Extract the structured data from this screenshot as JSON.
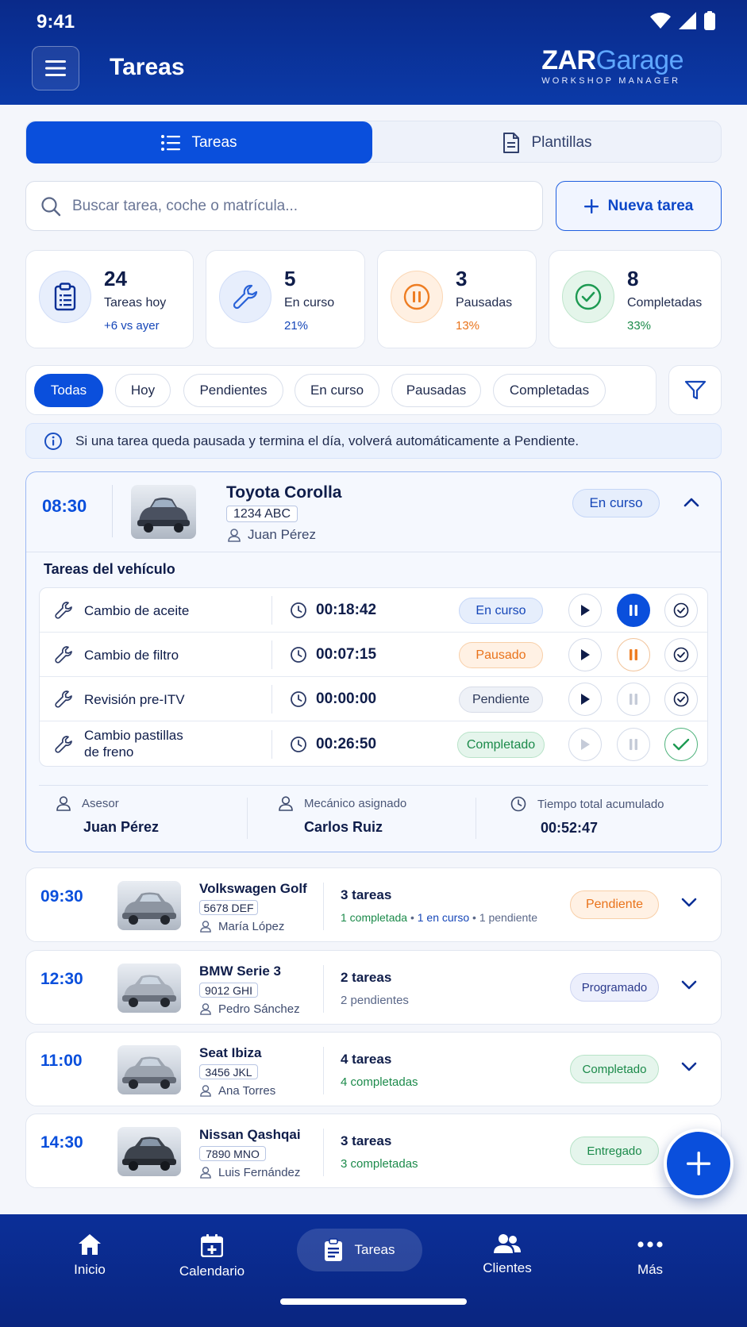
{
  "status_bar": {
    "time": "9:41"
  },
  "header": {
    "title": "Tareas",
    "logo_zar": "ZAR",
    "logo_garage": "Garage",
    "logo_sub": "WORKSHOP MANAGER"
  },
  "tabs": [
    {
      "label": "Tareas",
      "active": true
    },
    {
      "label": "Plantillas",
      "active": false
    }
  ],
  "search": {
    "placeholder": "Buscar tarea, coche o matrícula...",
    "value": ""
  },
  "new_task_label": "Nueva tarea",
  "stats": [
    {
      "number": "24",
      "label": "Tareas hoy",
      "sub": "+6 vs ayer",
      "color": "#1546b8"
    },
    {
      "number": "5",
      "label": "En curso",
      "sub": "21%",
      "color": "#1546b8"
    },
    {
      "number": "3",
      "label": "Pausadas",
      "sub": "13%",
      "color": "#e9731b"
    },
    {
      "number": "8",
      "label": "Completadas",
      "sub": "33%",
      "color": "#1b8a4a"
    }
  ],
  "filters": [
    "Todas",
    "Hoy",
    "Pendientes",
    "En curso",
    "Pausadas",
    "Completadas"
  ],
  "info_text": "Si una tarea queda pausada y termina el día, volverá automáticamente a Pendiente.",
  "expanded_card": {
    "time": "08:30",
    "model": "Toyota Corolla",
    "plate": "1234 ABC",
    "owner": "Juan Pérez",
    "status": "En curso",
    "subtitle": "Tareas del vehículo",
    "tasks": [
      {
        "name": "Cambio de aceite",
        "name2": "",
        "timer": "00:18:42",
        "status": "En curso"
      },
      {
        "name": "Cambio de filtro",
        "name2": "",
        "timer": "00:07:15",
        "status": "Pausado"
      },
      {
        "name": "Revisión pre-ITV",
        "name2": "",
        "timer": "00:00:00",
        "status": "Pendiente"
      },
      {
        "name": "Cambio pastillas",
        "name2": "de freno",
        "timer": "00:26:50",
        "status": "Completado"
      }
    ],
    "footer": {
      "advisor_label": "Asesor",
      "advisor": "Juan Pérez",
      "mechanic_label": "Mecánico asignado",
      "mechanic": "Carlos Ruiz",
      "total_label": "Tiempo total acumulado",
      "total": "00:52:47"
    }
  },
  "cards": [
    {
      "time": "09:30",
      "model": "Volkswagen Golf",
      "plate": "5678 DEF",
      "owner": "María López",
      "count": "3 tareas",
      "detail_parts": [
        "1 completada",
        " • ",
        "1 en curso",
        " • ",
        "1 pendiente"
      ],
      "status": "Pendiente"
    },
    {
      "time": "12:30",
      "model": "BMW Serie 3",
      "plate": "9012 GHI",
      "owner": "Pedro Sánchez",
      "count": "2 tareas",
      "detail": "2 pendientes",
      "status": "Programado"
    },
    {
      "time": "11:00",
      "model": "Seat Ibiza",
      "plate": "3456 JKL",
      "owner": "Ana Torres",
      "count": "4 tareas",
      "detail": "4 completadas",
      "status": "Completado"
    },
    {
      "time": "14:30",
      "model": "Nissan Qashqai",
      "plate": "7890 MNO",
      "owner": "Luis Fernández",
      "count": "3 tareas",
      "detail": "3 completadas",
      "status": "Entregado"
    }
  ],
  "nav": [
    "Inicio",
    "Calendario",
    "Tareas",
    "Clientes",
    "Más"
  ],
  "colors": {
    "primary": "#0a4fdc",
    "header": "#0b3aa8",
    "orange": "#e9731b",
    "green": "#1b8a4a"
  }
}
